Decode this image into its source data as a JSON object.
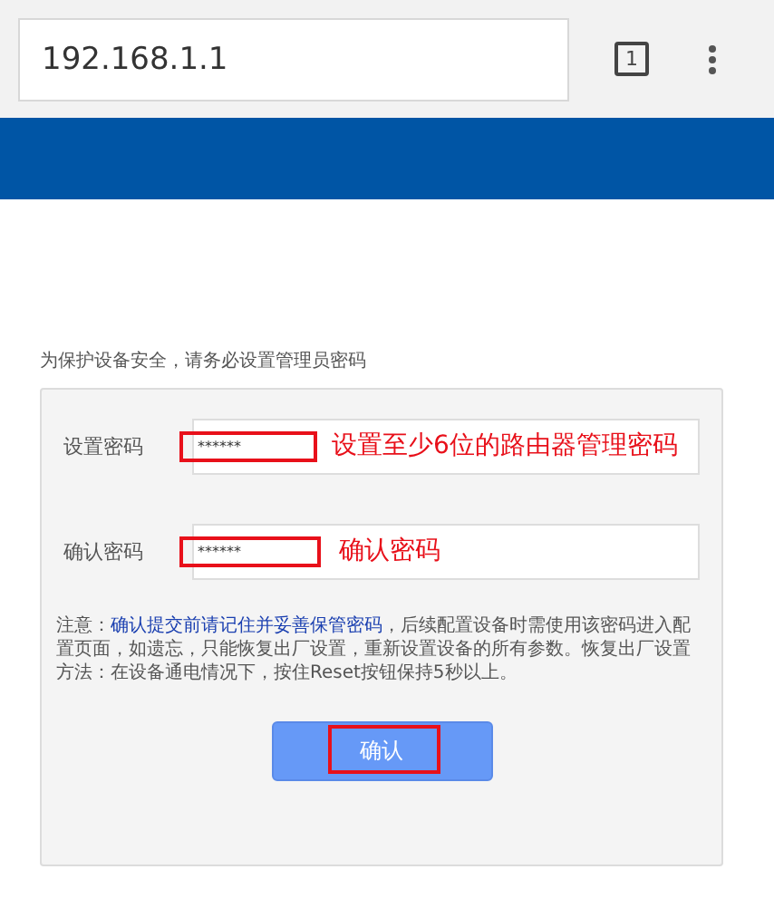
{
  "browser": {
    "url": "192.168.1.1",
    "tab_count": "1"
  },
  "intro": "为保护设备安全，请务必设置管理员密码",
  "fields": [
    {
      "label": "设置密码",
      "value": "******",
      "annotation": "设置至少6位的路由器管理密码"
    },
    {
      "label": "确认密码",
      "value": "******",
      "annotation": "确认密码"
    }
  ],
  "note": {
    "prefix": "注意：",
    "emphasis": "确认提交前请记住并妥善保管密码",
    "suffix": "，后续配置设备时需使用该密码进入配置页面，如遗忘，只能恢复出厂设置，重新设置设备的所有参数。恢复出厂设置方法：在设备通电情况下，按住Reset按钮保持5秒以上。"
  },
  "button": {
    "label": "确认"
  }
}
